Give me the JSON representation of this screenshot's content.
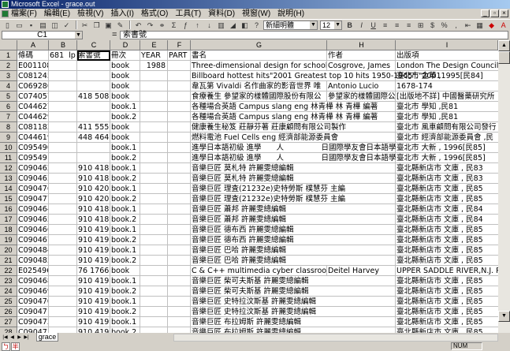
{
  "window": {
    "title": "Microsoft Excel - grace.out"
  },
  "menu": [
    "檔案(F)",
    "編輯(E)",
    "檢視(V)",
    "插入(I)",
    "格式(O)",
    "工具(T)",
    "資料(D)",
    "視窗(W)",
    "說明(H)"
  ],
  "toolbar": {
    "font_name": "新細明體",
    "font_size": "12"
  },
  "formula_bar": {
    "cell_ref": "C1",
    "equals": "=",
    "content": "索書號"
  },
  "columns": [
    "A",
    "B",
    "C",
    "D",
    "E",
    "F",
    "G",
    "H",
    "I"
  ],
  "rows": [
    {
      "n": "1",
      "a": "條碼",
      "b": "681",
      "b2": "lp",
      "c": "索書號",
      "d": "冊次",
      "e": "YEAR",
      "f": "PART",
      "g": "書名",
      "h": "作者",
      "i": "出版項"
    },
    {
      "n": "2",
      "a": "E001108",
      "b": "",
      "c": "",
      "d": "book",
      "e": "1988",
      "f": "",
      "g": "Three-dimensional design for schools by Ja",
      "h": "Cosgrove, James",
      "i": "London The Design Council ,19"
    },
    {
      "n": "3",
      "a": "C081245",
      "b": "",
      "c": "",
      "d": "book",
      "e": "",
      "f": "",
      "g": "Billboard hottest hits\"2001 Greatest top 10 hits 1950-1965\";\"2001",
      "h": "",
      "i": "臺北市 金革 ,1995[民84]"
    },
    {
      "n": "4",
      "a": "C069280",
      "b": "",
      "c": "",
      "d": "book",
      "e": "",
      "f": "",
      "g": "韋瓦第 Vivaldi 名作曲家的影音世界 唯",
      "h": "Antonio Lucio",
      "i": "1678-174"
    },
    {
      "n": "5",
      "a": "C074057",
      "b": "",
      "c": "418 5085",
      "d": "book",
      "e": "",
      "f": "",
      "g": "食療養生 參望家的樣體國際股份有限公",
      "h": "參望家的樣體國際公",
      "i": "[出版地不詳] 中國醫藥研究所"
    },
    {
      "n": "6",
      "a": "C044627",
      "b": "",
      "c": "",
      "d": "book.1",
      "e": "",
      "f": "",
      "g": "各種場合英語 Campus slang eng 林青樺 林 青樺 編著",
      "h": "",
      "i": "臺北市 學知 ,民81"
    },
    {
      "n": "7",
      "a": "C044629",
      "b": "",
      "c": "",
      "d": "book.2",
      "e": "",
      "f": "",
      "g": "各種場合英語 Campus slang eng 林青樺 林 青樺 編著",
      "h": "",
      "i": "臺北市 學知 ,民81"
    },
    {
      "n": "8",
      "a": "C081182",
      "b": "",
      "c": "411 5559",
      "d": "book",
      "e": "",
      "f": "",
      "g": "健康養生秘笈 莊靜芬著 莊康顧問有限公司製作",
      "h": "",
      "i": "臺北市 風車顧問有限公司發行"
    },
    {
      "n": "9",
      "a": "C044619",
      "b": "",
      "c": "448 4645",
      "d": "book",
      "e": "",
      "f": "",
      "g": "燃料電池 Fuel Cells eng 經濟部能源委員會",
      "h": "",
      "i": "臺北市 經濟部能源委員會 ,民"
    },
    {
      "n": "10",
      "a": "C095490",
      "b": "",
      "c": "",
      "d": "book.1",
      "e": "",
      "f": "",
      "g": "進學日本語初級 進學　　人　　　　　日國際學友會日本語學",
      "h": "",
      "i": "臺北市 大新 , 1996[民85]"
    },
    {
      "n": "11",
      "a": "C095491",
      "b": "",
      "c": "",
      "d": "book.2",
      "e": "",
      "f": "",
      "g": "進學日本語初級 進學　　人　　　　　日國際學友會日本語學",
      "h": "",
      "i": "臺北市 大新 , 1996[民85]"
    },
    {
      "n": "12",
      "a": "C090462",
      "b": "",
      "c": "910 4187",
      "d": "book.1",
      "e": "",
      "f": "",
      "g": "音樂巨匠 莫札特 許麗雯總編輯",
      "h": "",
      "i": "臺北縣新店市 文庫 , 民83"
    },
    {
      "n": "13",
      "a": "C090463",
      "b": "",
      "c": "910 4187",
      "d": "book.2",
      "e": "",
      "f": "",
      "g": "音樂巨匠 莫札特 許麗雯總編輯",
      "h": "",
      "i": "臺北縣新店市 文庫 , 民83"
    },
    {
      "n": "14",
      "a": "C090476",
      "b": "",
      "c": "910 4203",
      "d": "book.1",
      "e": "",
      "f": "",
      "g": "音樂巨匠 理査(21232e)史特勞斯 樸慧芬 主編",
      "h": "",
      "i": "臺北縣新店市 文庫 , 民85"
    },
    {
      "n": "15",
      "a": "C090477",
      "b": "",
      "c": "910 4203",
      "d": "book.2",
      "e": "",
      "f": "",
      "g": "音樂巨匠 理査(21232e)史特勞斯 樸慧芬 主編",
      "h": "",
      "i": "臺北縣新店市 文庫 , 民85"
    },
    {
      "n": "16",
      "a": "C090464",
      "b": "",
      "c": "910 4189",
      "d": "book.1",
      "e": "",
      "f": "",
      "g": "音樂巨匠 蕭邦 許麗雯總編輯",
      "h": "",
      "i": "臺北縣新店市 文庫 , 民84"
    },
    {
      "n": "17",
      "a": "C090465",
      "b": "",
      "c": "910 4189",
      "d": "book.2",
      "e": "",
      "f": "",
      "g": "音樂巨匠 蕭邦 許麗雯總編輯",
      "h": "",
      "i": "臺北縣新店市 文庫 , 民84"
    },
    {
      "n": "18",
      "a": "C090466",
      "b": "",
      "c": "910 4192",
      "d": "book.1",
      "e": "",
      "f": "",
      "g": "音樂巨匠 德布西 許麗雯總編輯",
      "h": "",
      "i": "臺北縣新店市 文庫 , 民85"
    },
    {
      "n": "19",
      "a": "C090467",
      "b": "",
      "c": "910 4192",
      "d": "book.2",
      "e": "",
      "f": "",
      "g": "音樂巨匠 德布西 許麗雯總編輯",
      "h": "",
      "i": "臺北縣新店市 文庫 , 民85"
    },
    {
      "n": "20",
      "a": "C090484",
      "b": "",
      "c": "910 4193",
      "d": "book.1",
      "e": "",
      "f": "",
      "g": "音樂巨匠 巴哈 許麗雯總編輯",
      "h": "",
      "i": "臺北縣新店市 文庫 , 民85"
    },
    {
      "n": "21",
      "a": "C090485",
      "b": "",
      "c": "910 4193",
      "d": "book.2",
      "e": "",
      "f": "",
      "g": "音樂巨匠 巴哈 許麗雯總編輯",
      "h": "",
      "i": "臺北縣新店市 文庫 , 民85"
    },
    {
      "n": "22",
      "a": "E025496",
      "b": "",
      "c": "76 1766",
      "d": "book",
      "e": "",
      "f": "",
      "g": "C & C++ multimedia cyber classroom Harv",
      "h": "Deitel Harvey",
      "i": "UPPER SADDLE RIVER,N.J. Pre"
    },
    {
      "n": "23",
      "a": "C090468",
      "b": "",
      "c": "910 4195",
      "d": "book.1",
      "e": "",
      "f": "",
      "g": "音樂巨匠 柴可夫斯基 許麗雯總編輯",
      "h": "",
      "i": "臺北縣新店市 文庫 , 民85"
    },
    {
      "n": "24",
      "a": "C090469",
      "b": "",
      "c": "910 4195",
      "d": "book.2",
      "e": "",
      "f": "",
      "g": "音樂巨匠 柴可夫斯基 許麗雯總編輯",
      "h": "",
      "i": "臺北縣新店市 文庫 , 民85"
    },
    {
      "n": "25",
      "a": "C090470",
      "b": "",
      "c": "910 4197",
      "d": "book.1",
      "e": "",
      "f": "",
      "g": "音樂巨匠 史特拉汶斯基 許麗雯總編輯",
      "h": "",
      "i": "臺北縣新店市 文庫 , 民85"
    },
    {
      "n": "26",
      "a": "C090471",
      "b": "",
      "c": "910 4197",
      "d": "book.2",
      "e": "",
      "f": "",
      "g": "音樂巨匠 史特拉汶斯基 許麗雯總編輯",
      "h": "",
      "i": "臺北縣新店市 文庫 , 民85"
    },
    {
      "n": "27",
      "a": "C090472",
      "b": "",
      "c": "910 4199",
      "d": "book.1",
      "e": "",
      "f": "",
      "g": "音樂巨匠 布拉姆斯 許麗雯總編輯",
      "h": "",
      "i": "臺北縣新店市 文庫 , 民85"
    },
    {
      "n": "28",
      "a": "C090473",
      "b": "",
      "c": "910 4199",
      "d": "book.2",
      "e": "",
      "f": "",
      "g": "音樂巨匠 布拉姆斯 許麗雯總編輯",
      "h": "",
      "i": "臺北縣新店市 文庫 , 民85"
    }
  ],
  "sheet_tab": "grace",
  "ime": [
    "ㄅ",
    "半"
  ],
  "status": {
    "num": "NUM"
  }
}
